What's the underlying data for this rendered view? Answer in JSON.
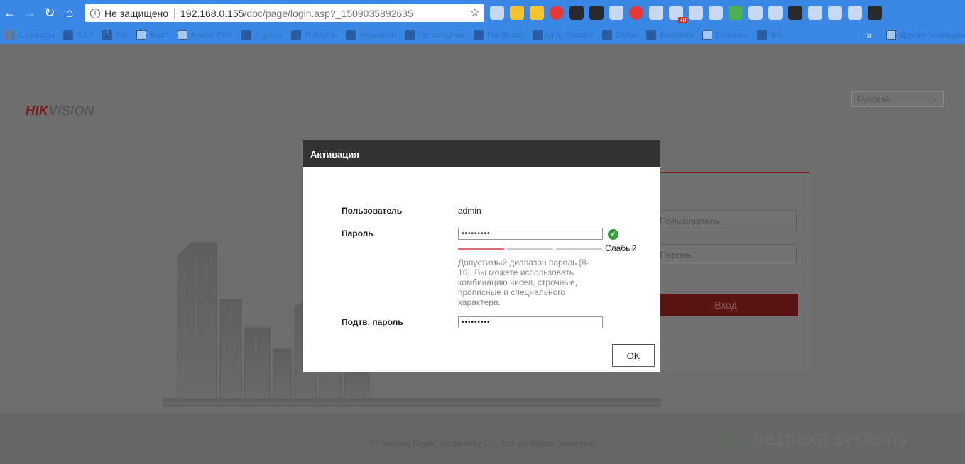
{
  "browser": {
    "security_label": "Не защищено",
    "url_host": "192.168.0.155",
    "url_path": "/doc/page/login.asp?_1509035892635",
    "ext_badge": "+9",
    "bookmarks": [
      "Сервисы",
      "ХХХ",
      "ФБ",
      "Bash",
      "Книги PDF",
      "Ingress",
      "Я.Карты",
      "Ingushkin",
      "Переводчик",
      "Ru-Board",
      "Digg Reader",
      "Dofus",
      "Evernote",
      "Dropbox",
      "ФБ"
    ],
    "bookmarks_more": "»",
    "other_bookmarks": "Другие закладки"
  },
  "page": {
    "logo_hik": "HIK",
    "logo_vision": "VISION",
    "language": "Русский",
    "login": {
      "user_placeholder": "Пользователь",
      "password_placeholder": "Пароль",
      "button": "Вход"
    },
    "copyright": "©Hikvision Digital Technology Co., Ltd. All Rights Reserved.",
    "watermark_brand": "ajax",
    "watermark_rest": "bezpeka.systems"
  },
  "modal": {
    "title": "Активация",
    "user_label": "Пользователь",
    "user_value": "admin",
    "password_label": "Пароль",
    "password_value": "•••••••••",
    "strength_label": "Слабый",
    "strength_level": 0.33,
    "hint": "Допустимый диапазон пароль [8-16]. Вы можете использовать комбинацию чисел, строчные, прописные и специального характера.",
    "confirm_label": "Подтв. пароль",
    "confirm_value": "•••••••••",
    "ok_button": "OK"
  },
  "colors": {
    "chrome_blue": "#3a87e6",
    "modal_header": "#333333",
    "strength_weak": "#e06b7d",
    "check_green": "#2e9e3a",
    "brand_red": "#7a1a1a"
  }
}
